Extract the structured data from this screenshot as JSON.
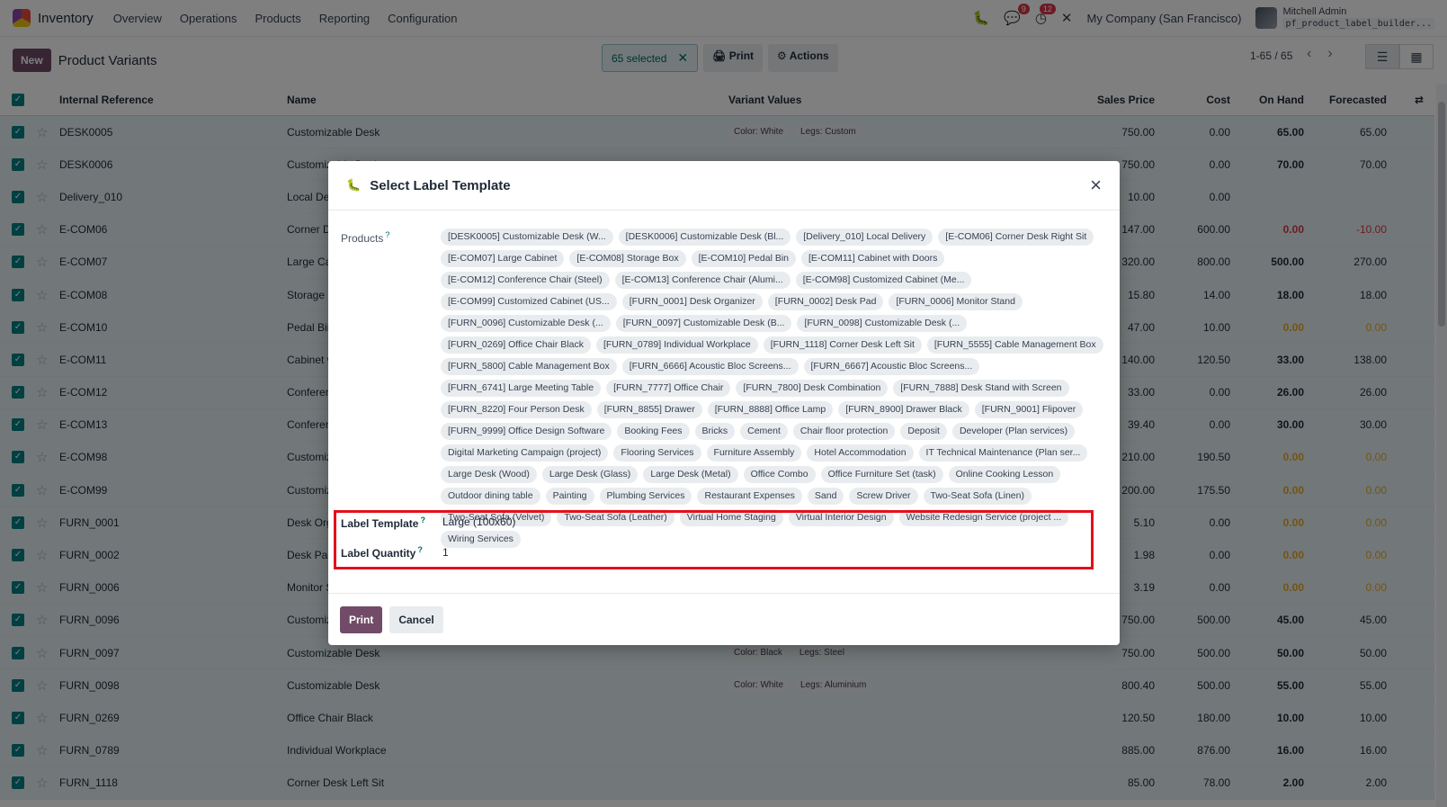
{
  "navbar": {
    "app_name": "Inventory",
    "menu": [
      "Overview",
      "Operations",
      "Products",
      "Reporting",
      "Configuration"
    ],
    "chat_badge": "9",
    "activity_badge": "12",
    "company": "My Company (San Francisco)",
    "user_name": "Mitchell Admin",
    "user_db": "pf_product_label_builder..."
  },
  "control": {
    "new_label": "New",
    "title": "Product Variants",
    "selected_label": "65 selected",
    "print_label": "Print",
    "actions_label": "Actions",
    "pager": "1-65 / 65"
  },
  "list": {
    "headers": {
      "ref": "Internal Reference",
      "name": "Name",
      "variants": "Variant Values",
      "sales": "Sales Price",
      "cost": "Cost",
      "onhand": "On Hand",
      "forecast": "Forecasted"
    },
    "rows": [
      {
        "ref": "DESK0005",
        "name": "Customizable Desk",
        "tags": [
          "Color: White",
          "Legs: Custom"
        ],
        "sales": "750.00",
        "cost": "0.00",
        "onhand": "65.00",
        "forecast": "65.00",
        "state": ""
      },
      {
        "ref": "DESK0006",
        "name": "Customizable Desk",
        "tags": [],
        "sales": "750.00",
        "cost": "0.00",
        "onhand": "70.00",
        "forecast": "70.00",
        "state": ""
      },
      {
        "ref": "Delivery_010",
        "name": "Local Delivery",
        "tags": [],
        "sales": "10.00",
        "cost": "0.00",
        "onhand": "",
        "forecast": "",
        "state": ""
      },
      {
        "ref": "E-COM06",
        "name": "Corner Desk Right Sit",
        "tags": [],
        "sales": "147.00",
        "cost": "600.00",
        "onhand": "0.00",
        "forecast": "-10.00",
        "state": "red"
      },
      {
        "ref": "E-COM07",
        "name": "Large Cabinet",
        "tags": [],
        "sales": "320.00",
        "cost": "800.00",
        "onhand": "500.00",
        "forecast": "270.00",
        "state": ""
      },
      {
        "ref": "E-COM08",
        "name": "Storage Box",
        "tags": [],
        "sales": "15.80",
        "cost": "14.00",
        "onhand": "18.00",
        "forecast": "18.00",
        "state": ""
      },
      {
        "ref": "E-COM10",
        "name": "Pedal Bin",
        "tags": [],
        "sales": "47.00",
        "cost": "10.00",
        "onhand": "0.00",
        "forecast": "0.00",
        "state": "yellow"
      },
      {
        "ref": "E-COM11",
        "name": "Cabinet with Doors",
        "tags": [],
        "sales": "140.00",
        "cost": "120.50",
        "onhand": "33.00",
        "forecast": "138.00",
        "state": ""
      },
      {
        "ref": "E-COM12",
        "name": "Conference Chair",
        "tags": [],
        "sales": "33.00",
        "cost": "0.00",
        "onhand": "26.00",
        "forecast": "26.00",
        "state": ""
      },
      {
        "ref": "E-COM13",
        "name": "Conference Chair",
        "tags": [],
        "sales": "39.40",
        "cost": "0.00",
        "onhand": "30.00",
        "forecast": "30.00",
        "state": ""
      },
      {
        "ref": "E-COM98",
        "name": "Customized Cabinet",
        "tags": [],
        "sales": "210.00",
        "cost": "190.50",
        "onhand": "0.00",
        "forecast": "0.00",
        "state": "yellow"
      },
      {
        "ref": "E-COM99",
        "name": "Customized Cabinet",
        "tags": [],
        "sales": "200.00",
        "cost": "175.50",
        "onhand": "0.00",
        "forecast": "0.00",
        "state": "yellow"
      },
      {
        "ref": "FURN_0001",
        "name": "Desk Organizer",
        "tags": [],
        "sales": "5.10",
        "cost": "0.00",
        "onhand": "0.00",
        "forecast": "0.00",
        "state": "yellow"
      },
      {
        "ref": "FURN_0002",
        "name": "Desk Pad",
        "tags": [],
        "sales": "1.98",
        "cost": "0.00",
        "onhand": "0.00",
        "forecast": "0.00",
        "state": "yellow"
      },
      {
        "ref": "FURN_0006",
        "name": "Monitor Stand",
        "tags": [],
        "sales": "3.19",
        "cost": "0.00",
        "onhand": "0.00",
        "forecast": "0.00",
        "state": "yellow"
      },
      {
        "ref": "FURN_0096",
        "name": "Customizable Desk",
        "tags": [],
        "sales": "750.00",
        "cost": "500.00",
        "onhand": "45.00",
        "forecast": "45.00",
        "state": ""
      },
      {
        "ref": "FURN_0097",
        "name": "Customizable Desk",
        "tags": [
          "Color: Black",
          "Legs: Steel"
        ],
        "sales": "750.00",
        "cost": "500.00",
        "onhand": "50.00",
        "forecast": "50.00",
        "state": ""
      },
      {
        "ref": "FURN_0098",
        "name": "Customizable Desk",
        "tags": [
          "Color: White",
          "Legs: Aluminium"
        ],
        "sales": "800.40",
        "cost": "500.00",
        "onhand": "55.00",
        "forecast": "55.00",
        "state": ""
      },
      {
        "ref": "FURN_0269",
        "name": "Office Chair Black",
        "tags": [],
        "sales": "120.50",
        "cost": "180.00",
        "onhand": "10.00",
        "forecast": "10.00",
        "state": ""
      },
      {
        "ref": "FURN_0789",
        "name": "Individual Workplace",
        "tags": [],
        "sales": "885.00",
        "cost": "876.00",
        "onhand": "16.00",
        "forecast": "16.00",
        "state": ""
      },
      {
        "ref": "FURN_1118",
        "name": "Corner Desk Left Sit",
        "tags": [],
        "sales": "85.00",
        "cost": "78.00",
        "onhand": "2.00",
        "forecast": "2.00",
        "state": ""
      }
    ]
  },
  "modal": {
    "title": "Select Label Template",
    "products_label": "Products",
    "products": [
      "[DESK0005] Customizable Desk (W...",
      "[DESK0006] Customizable Desk (Bl...",
      "[Delivery_010] Local Delivery",
      "[E-COM06] Corner Desk Right Sit",
      "[E-COM07] Large Cabinet",
      "[E-COM08] Storage Box",
      "[E-COM10] Pedal Bin",
      "[E-COM11] Cabinet with Doors",
      "[E-COM12] Conference Chair (Steel)",
      "[E-COM13] Conference Chair (Alumi...",
      "[E-COM98] Customized Cabinet (Me...",
      "[E-COM99] Customized Cabinet (US...",
      "[FURN_0001] Desk Organizer",
      "[FURN_0002] Desk Pad",
      "[FURN_0006] Monitor Stand",
      "[FURN_0096] Customizable Desk (...",
      "[FURN_0097] Customizable Desk (B...",
      "[FURN_0098] Customizable Desk (...",
      "[FURN_0269] Office Chair Black",
      "[FURN_0789] Individual Workplace",
      "[FURN_1118] Corner Desk Left Sit",
      "[FURN_5555] Cable Management Box",
      "[FURN_5800] Cable Management Box",
      "[FURN_6666] Acoustic Bloc Screens...",
      "[FURN_6667] Acoustic Bloc Screens...",
      "[FURN_6741] Large Meeting Table",
      "[FURN_7777] Office Chair",
      "[FURN_7800] Desk Combination",
      "[FURN_7888] Desk Stand with Screen",
      "[FURN_8220] Four Person Desk",
      "[FURN_8855] Drawer",
      "[FURN_8888] Office Lamp",
      "[FURN_8900] Drawer Black",
      "[FURN_9001] Flipover",
      "[FURN_9999] Office Design Software",
      "Booking Fees",
      "Bricks",
      "Cement",
      "Chair floor protection",
      "Deposit",
      "Developer (Plan services)",
      "Digital Marketing Campaign (project)",
      "Flooring Services",
      "Furniture Assembly",
      "Hotel Accommodation",
      "IT Technical Maintenance (Plan ser...",
      "Large Desk (Wood)",
      "Large Desk (Glass)",
      "Large Desk (Metal)",
      "Office Combo",
      "Office Furniture Set (task)",
      "Online Cooking Lesson",
      "Outdoor dining table",
      "Painting",
      "Plumbing Services",
      "Restaurant Expenses",
      "Sand",
      "Screw Driver",
      "Two-Seat Sofa (Linen)",
      "Two-Seat Sofa (Velvet)",
      "Two-Seat Sofa (Leather)",
      "Virtual Home Staging",
      "Virtual Interior Design",
      "Website Redesign Service (project ...",
      "Wiring Services"
    ],
    "template_label": "Label Template",
    "template_value": "Large (100x60)",
    "quantity_label": "Label Quantity",
    "quantity_value": "1",
    "help_mark": "?",
    "print_label": "Print",
    "cancel_label": "Cancel"
  }
}
